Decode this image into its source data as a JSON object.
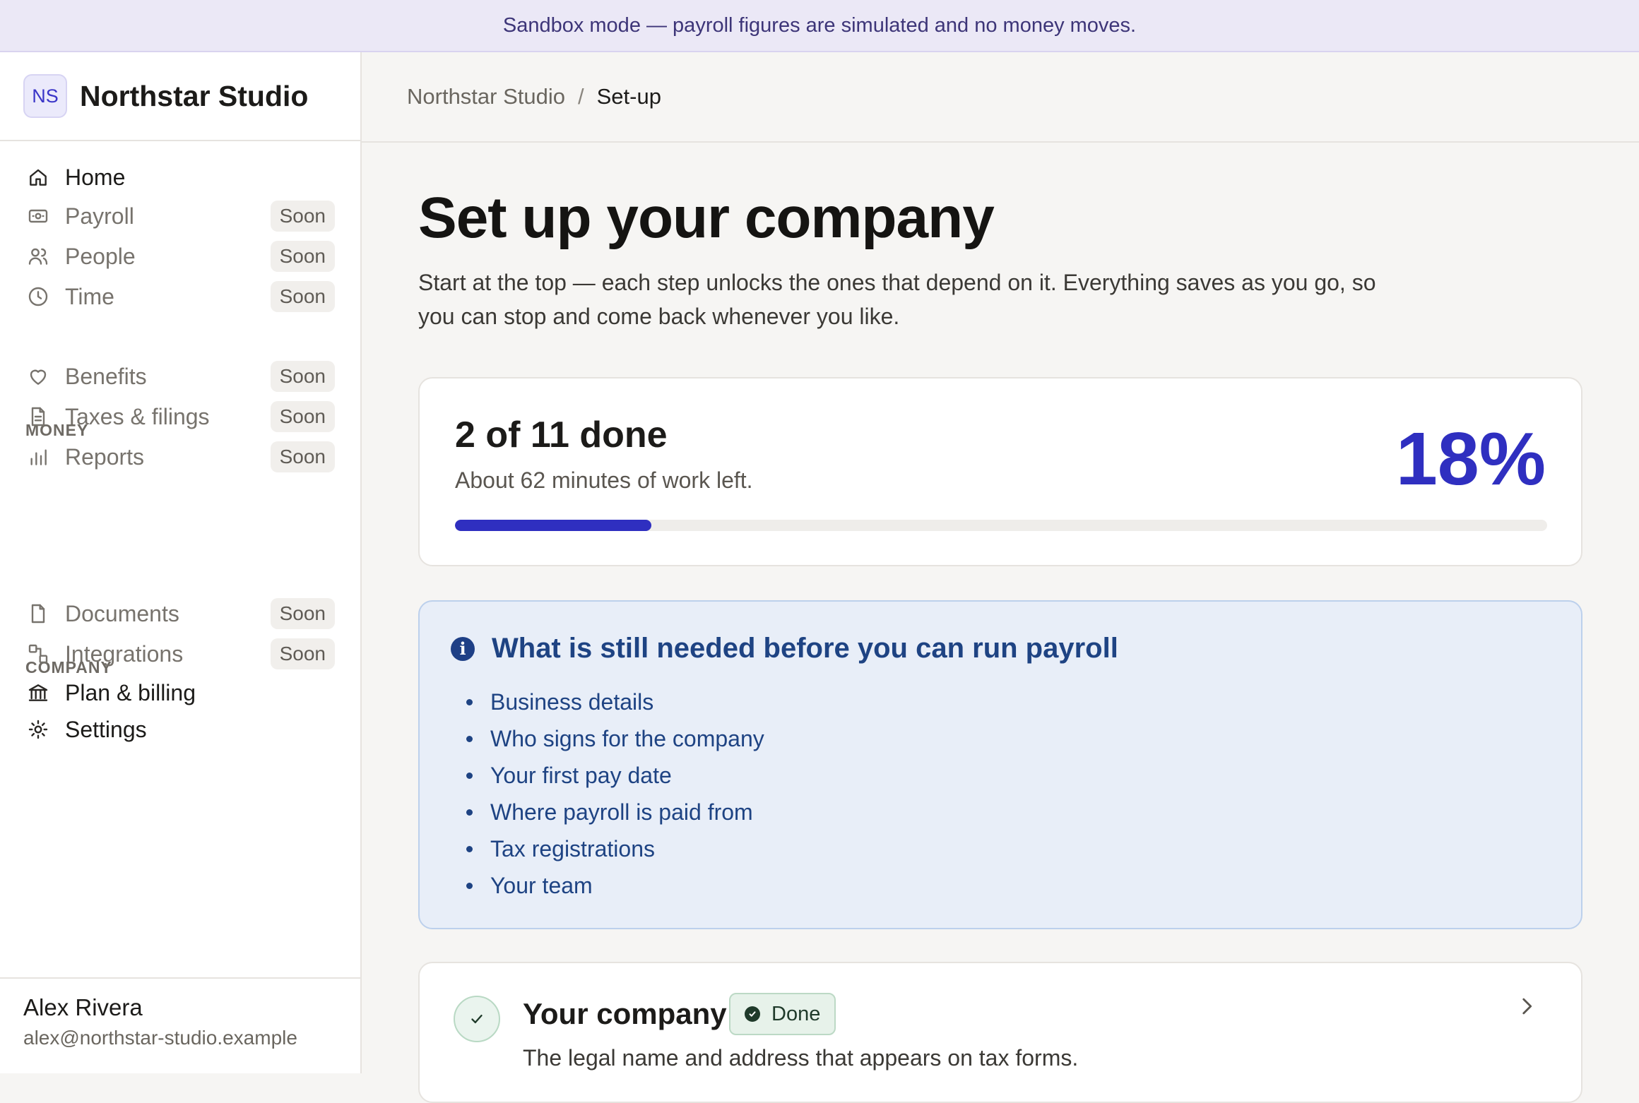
{
  "banner": {
    "text": "Sandbox mode — payroll figures are simulated and no money moves."
  },
  "brand": {
    "initials": "NS",
    "name": "Northstar Studio"
  },
  "sidebar": {
    "items": [
      {
        "label": "Home",
        "icon": "home-icon",
        "badge": null
      },
      {
        "label": "Payroll",
        "icon": "payroll-icon",
        "badge": "Soon"
      },
      {
        "label": "People",
        "icon": "people-icon",
        "badge": "Soon"
      },
      {
        "label": "Time",
        "icon": "clock-icon",
        "badge": "Soon"
      }
    ],
    "money_label": "MONEY",
    "money_items": [
      {
        "label": "Benefits",
        "icon": "heart-icon",
        "badge": "Soon"
      },
      {
        "label": "Taxes & filings",
        "icon": "document-icon",
        "badge": "Soon"
      },
      {
        "label": "Reports",
        "icon": "bar-chart-icon",
        "badge": "Soon"
      }
    ],
    "company_label": "COMPANY",
    "company_items": [
      {
        "label": "Documents",
        "icon": "file-icon",
        "badge": "Soon"
      },
      {
        "label": "Integrations",
        "icon": "integrations-icon",
        "badge": "Soon"
      },
      {
        "label": "Plan & billing",
        "icon": "bank-icon",
        "badge": null
      },
      {
        "label": "Settings",
        "icon": "settings-icon",
        "badge": null
      }
    ]
  },
  "user": {
    "name": "Alex Rivera",
    "email": "alex@northstar-studio.example"
  },
  "breadcrumb": {
    "parent": "Northstar Studio",
    "separator": "/",
    "current": "Set-up"
  },
  "page": {
    "title": "Set up your company",
    "subtitle": "Start at the top — each step unlocks the ones that depend on it. Everything saves as you go, so you can stop and come back whenever you like."
  },
  "progress": {
    "title": "2 of 11 done",
    "subtitle": "About 62 minutes of work left.",
    "percent_label": "18%",
    "fraction": 0.18
  },
  "info": {
    "title": "What is still needed before you can run payroll",
    "items": [
      "Business details",
      "Who signs for the company",
      "Your first pay date",
      "Where payroll is paid from",
      "Tax registrations",
      "Your team"
    ]
  },
  "step": {
    "title": "Your company",
    "badge": "Done",
    "description": "The legal name and address that appears on tax forms."
  },
  "colors": {
    "accent": "#2f2fc0",
    "banner_bg": "#ebe8f6",
    "info_bg": "#e8eef8",
    "info_text": "#1e4383",
    "done_bg": "#e7f2ea"
  }
}
